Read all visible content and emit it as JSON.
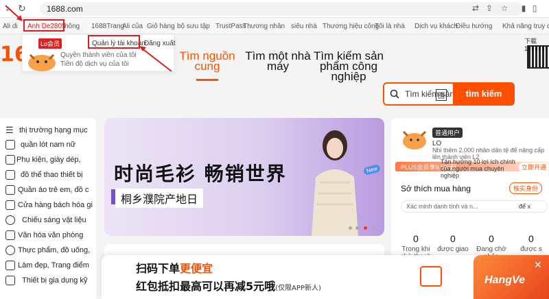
{
  "browser": {
    "url": "1688.com"
  },
  "topnav": {
    "items": [
      "Ali di",
      "Anh De2805",
      "hông",
      "1688Trang",
      "Ali của",
      "Giỏ hàng",
      "bộ sưu tập",
      "TrustPass",
      "Thương nhân",
      "siêu nhà",
      "Thương hiệu công",
      "Tôi là nhà",
      "Dịch vụ khách",
      "Điều hướng",
      "Khả năng truy cập"
    ]
  },
  "dropdown": {
    "member_tag": "Lo会员",
    "account_link": "Quản lý tài khoản",
    "logout_link": "Đăng xuất",
    "line1": "Quyền thành viên của tôi",
    "line2": "Tiền độ dịch vụ của tôi"
  },
  "logo": {
    "text": "168"
  },
  "header_tabs": [
    {
      "label": "Tìm nguồn cung",
      "active": true
    },
    {
      "label": "Tìm một nhà máy",
      "active": false
    },
    {
      "label": "Tìm kiếm sản phẩm công nghiệp",
      "active": false
    }
  ],
  "qr": {
    "label": "下载1688AP"
  },
  "search": {
    "placeholder": "Tìm kiếm sản",
    "button": "tìm kiếm",
    "badge": "图"
  },
  "sidebar": {
    "title": "thị trường hạng mục",
    "items": [
      {
        "icon": "shirt-icon",
        "label": "quần lót nam   nữ"
      },
      {
        "icon": "accessory-icon",
        "label": "Phụ kiện,   giày dép,"
      },
      {
        "icon": "toy-icon",
        "label": "đồ thể thao thiết bị"
      },
      {
        "icon": "baby-icon",
        "label": "Quần áo trẻ em,   đồ c"
      },
      {
        "icon": "store-icon",
        "label": "Cửa hàng bách hóa gi"
      },
      {
        "icon": "bulb-icon",
        "label": "Chiếu sáng   vật liệu"
      },
      {
        "icon": "office-icon",
        "label": "Văn hóa văn phòng"
      },
      {
        "icon": "food-icon",
        "label": "Thực phẩm, đồ uống,"
      },
      {
        "icon": "beauty-icon",
        "label": "Làm đẹp, Trang điểm"
      },
      {
        "icon": "camera-icon",
        "label": "Thiết bị gia dụng   kỹ"
      }
    ]
  },
  "banner": {
    "title": "时尚毛衫  畅销世界",
    "subtitle": "桐乡濮院产地日",
    "tag": "New"
  },
  "user_panel": {
    "badge": "普通用户",
    "name": "LO",
    "hint": "Nhi thêm 2.000 nhân dân tệ để nâng cấp",
    "hint2": "lên thành viên L2",
    "plus_tag": "PLUS会员享9.5折起",
    "plus_text": "Tận hưởng 10 lợi ích chính của người mua chuyên nghiệp",
    "plus_open": "立即开通",
    "pref_title": "Sở thích mua hàng",
    "verify_btn": "核实身份",
    "verify_text": "Xác minh danh tính và n...",
    "verify_more": "để x",
    "stats": [
      {
        "num": "0",
        "label": "Trong khi chờ thanh"
      },
      {
        "num": "0",
        "label": "được giao"
      },
      {
        "num": "0",
        "label": "Đang chờ nhận"
      },
      {
        "num": "0",
        "label": "được s"
      }
    ]
  },
  "promo": {
    "line1_a": "扫码下单",
    "line1_b": "更便宜",
    "line2": "红包抵扣最高可以再减5元哦",
    "line2_small": "(仅限APP新人)",
    "watermark": "HangVe",
    "close": "✕"
  },
  "colors": {
    "brand": "#ff5000",
    "annotation": "#d81e1e"
  }
}
